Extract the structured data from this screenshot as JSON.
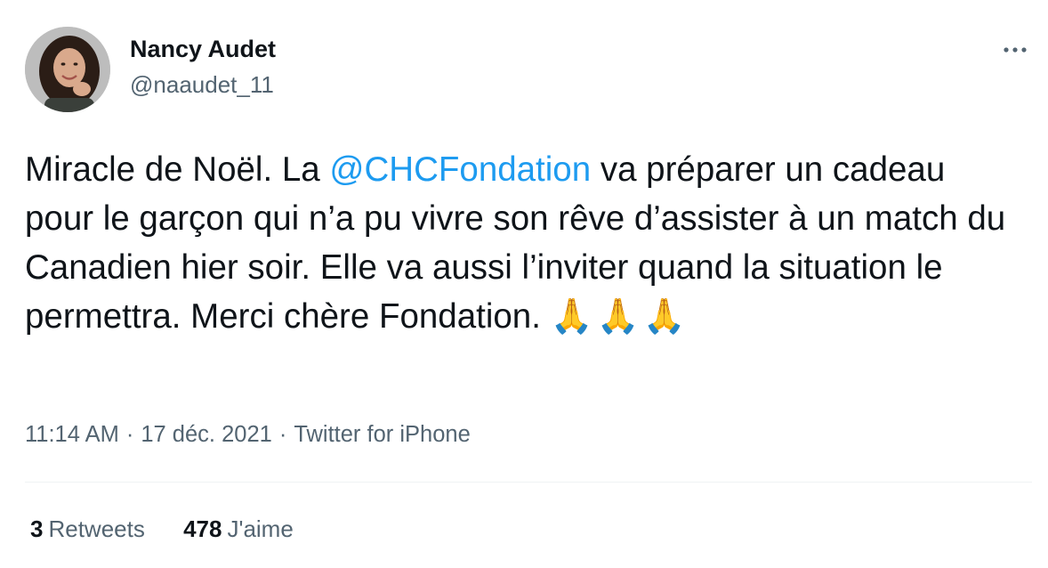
{
  "user": {
    "name": "Nancy Audet",
    "handle": "@naaudet_11"
  },
  "tweet": {
    "text_before": "Miracle de Noël. La ",
    "mention": "@CHCFondation",
    "text_after": " va préparer un cadeau pour le garçon qui n’a pu vivre son rêve d’assister à un match du Canadien hier soir. Elle va aussi l’inviter quand la situation le permettra. Merci chère Fondation. ",
    "emoji": "🙏🙏🙏"
  },
  "meta": {
    "time": "11:14 AM",
    "separator": "·",
    "date": "17 déc. 2021",
    "source": "Twitter for iPhone"
  },
  "stats": {
    "retweets_count": "3",
    "retweets_label": "Retweets",
    "likes_count": "478",
    "likes_label": "J'aime"
  },
  "colors": {
    "text": "#0f1419",
    "secondary": "#536471",
    "link": "#1d9bf0",
    "divider": "#eff3f4"
  },
  "icons": {
    "more": "more-horizontal-icon",
    "emoji": "folded-hands-emoji"
  }
}
